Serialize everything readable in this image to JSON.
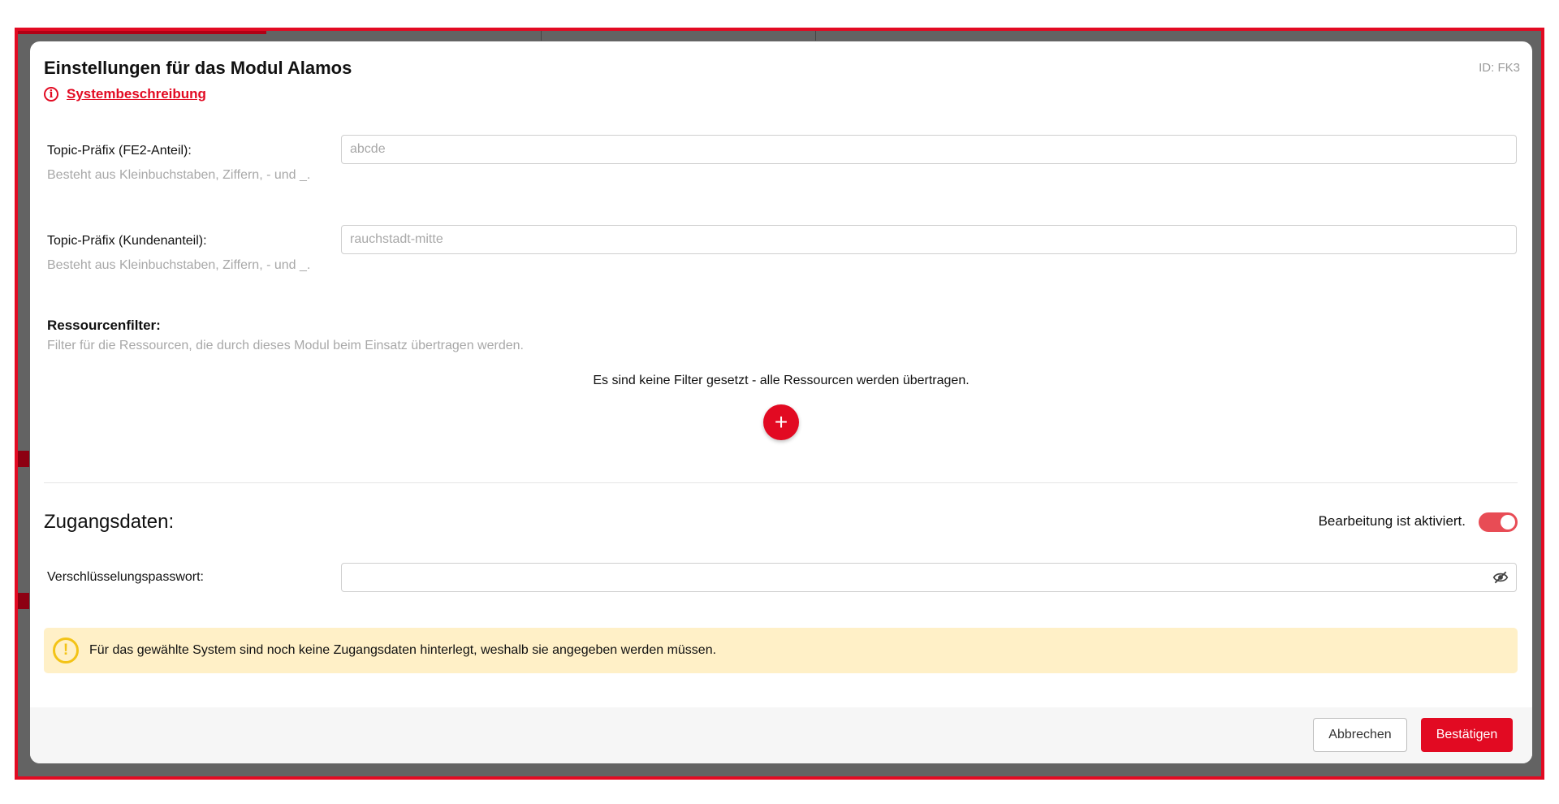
{
  "modal": {
    "title": "Einstellungen für das Modul Alamos",
    "id_label": "ID: FK3",
    "description_link": "Systembeschreibung"
  },
  "fields": {
    "topic_fe2": {
      "label": "Topic-Präfix (FE2-Anteil):",
      "hint": "Besteht aus Kleinbuchstaben, Ziffern, - und _.",
      "placeholder": "abcde",
      "value": ""
    },
    "topic_customer": {
      "label": "Topic-Präfix (Kundenanteil):",
      "hint": "Besteht aus Kleinbuchstaben, Ziffern, - und _.",
      "placeholder": "rauchstadt-mitte",
      "value": ""
    }
  },
  "resource_filter": {
    "title": "Ressourcenfilter:",
    "hint": "Filter für die Ressourcen, die durch dieses Modul beim Einsatz übertragen werden.",
    "empty_text": "Es sind keine Filter gesetzt - alle Ressourcen werden übertragen.",
    "add_label": "+"
  },
  "access_data": {
    "title": "Zugangsdaten:",
    "toggle_label": "Bearbeitung ist aktiviert.",
    "toggle_on": true,
    "password_label": "Verschlüsselungspasswort:",
    "password_value": ""
  },
  "warning": {
    "icon": "!",
    "text": "Für das gewählte System sind noch keine Zugangsdaten hinterlegt, weshalb sie angegeben werden müssen."
  },
  "footer": {
    "cancel_label": "Abbrechen",
    "confirm_label": "Bestätigen"
  },
  "colors": {
    "accent": "#e20a22",
    "warning_bg": "#fff0c7",
    "warning_icon": "#f3c316",
    "toggle_on": "#e84c55"
  },
  "icons": {
    "info": "info-icon",
    "add": "plus-icon",
    "password_visibility": "eye-off-icon",
    "warning": "exclamation-icon"
  }
}
